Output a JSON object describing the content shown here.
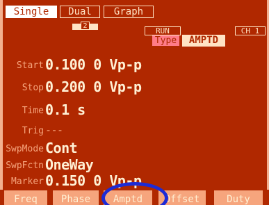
{
  "tabs": {
    "single": "Single",
    "dual": "Dual",
    "graph": "Graph"
  },
  "indicator": {
    "memory_number": "2"
  },
  "status": {
    "run": "RUN",
    "channel": "CH 1",
    "type_label": "Type",
    "type_value": "AMPTD"
  },
  "params": {
    "start": {
      "label": "Start",
      "value": "0.100 0 Vp-p"
    },
    "stop": {
      "label": "Stop",
      "value": "0.200 0 Vp-p"
    },
    "time": {
      "label": "Time",
      "value": "0.1 s"
    },
    "trig": {
      "label": "Trig",
      "value": "---"
    },
    "swpmode": {
      "label": "SwpMode",
      "value": "Cont"
    },
    "swpfctn": {
      "label": "SwpFctn",
      "value": "OneWay"
    },
    "marker": {
      "label": "Marker",
      "value": "0.150 0 Vp-p"
    }
  },
  "softkeys": {
    "freq": "Freq",
    "phase": "Phase",
    "amptd": "Amptd",
    "offset": "Offset",
    "duty": "Duty"
  },
  "colors": {
    "background": "#b02800",
    "label": "#f6a57d",
    "value": "#fff0d4",
    "type_badge": "#ff7c88",
    "highlight_ring": "#1d2bd6"
  }
}
